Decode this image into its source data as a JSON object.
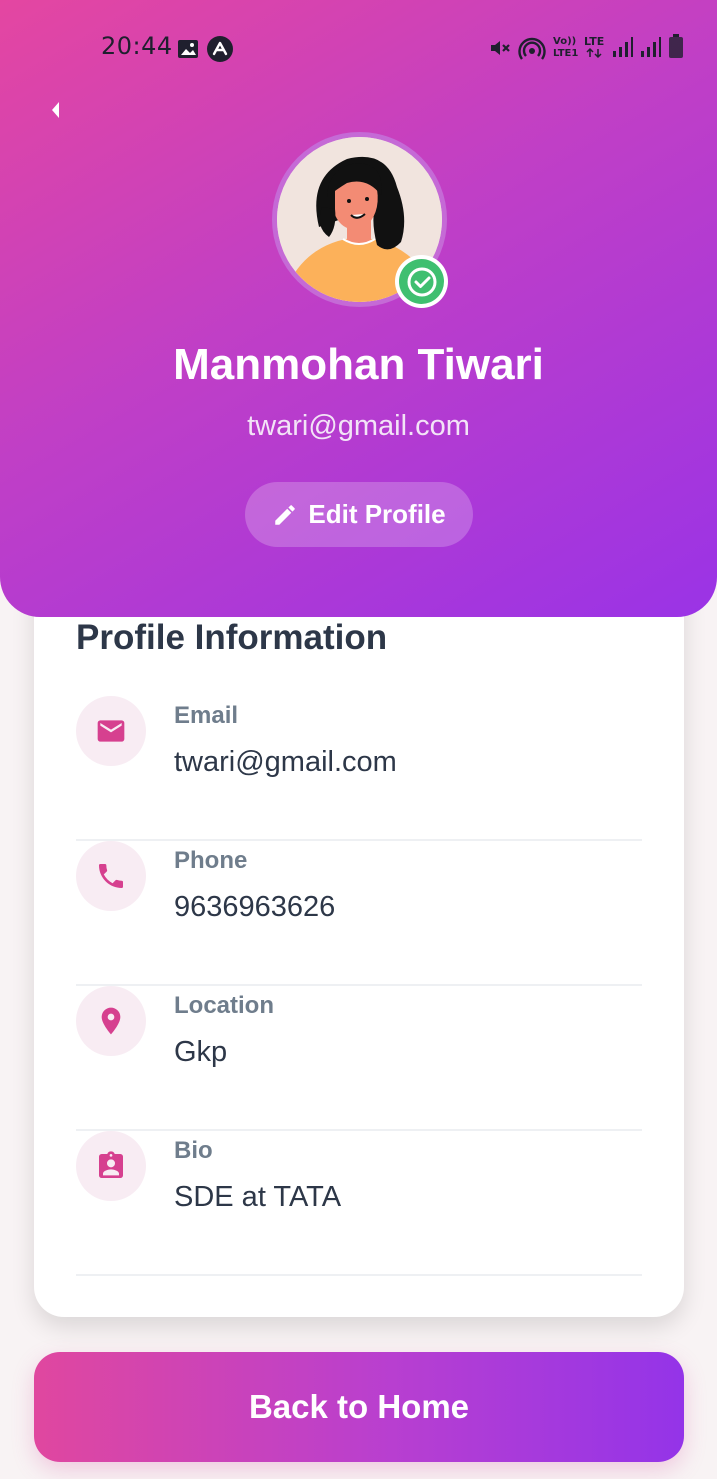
{
  "status_bar": {
    "time": "20:44",
    "left_icons": [
      "image-icon",
      "app-notification-icon"
    ],
    "right_icons": [
      "mute-icon",
      "hotspot-icon",
      "volte-icon",
      "lte-icon",
      "signal-icon",
      "signal-icon",
      "battery-icon"
    ],
    "volte_text": "Vo))\nLTE1",
    "lte_text": "LTE"
  },
  "header": {
    "back_icon": "back-arrow-icon",
    "name": "Manmohan Tiwari",
    "email": "twari@gmail.com",
    "edit_button_label": "Edit Profile",
    "edit_icon": "pencil-icon",
    "verified_icon": "check-circle-icon"
  },
  "card": {
    "title": "Profile Information",
    "items": [
      {
        "label": "Email",
        "value": "twari@gmail.com",
        "icon": "mail-icon"
      },
      {
        "label": "Phone",
        "value": "9636963626",
        "icon": "phone-icon"
      },
      {
        "label": "Location",
        "value": "Gkp",
        "icon": "location-pin-icon"
      },
      {
        "label": "Bio",
        "value": "SDE at TATA",
        "icon": "contact-badge-icon"
      }
    ]
  },
  "home_button_label": "Back to Home",
  "colors": {
    "gradient_start": "#e446a1",
    "gradient_end": "#9a33e6",
    "accent_pink": "#d6408f",
    "verified_green": "#3fbf70"
  }
}
